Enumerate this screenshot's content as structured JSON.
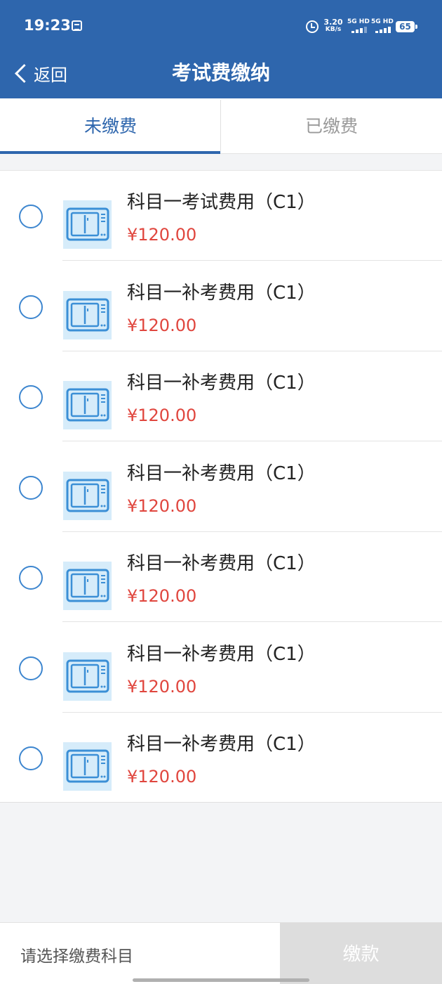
{
  "status_bar": {
    "time": "19:23",
    "net_speed_value": "3.20",
    "net_speed_unit": "KB/s",
    "signal1_label": "5G HD",
    "signal2_label": "5G HD",
    "battery": "65"
  },
  "header": {
    "back_label": "返回",
    "title": "考试费缴纳",
    "color": "#2e66ad"
  },
  "tabs": [
    {
      "label": "未缴费",
      "active": true
    },
    {
      "label": "已缴费",
      "active": false
    }
  ],
  "items": [
    {
      "name": "科目一考试费用（C1）",
      "price": "¥120.00",
      "selected": false,
      "icon": "exam-fee-icon"
    },
    {
      "name": "科目一补考费用（C1）",
      "price": "¥120.00",
      "selected": false,
      "icon": "exam-fee-icon"
    },
    {
      "name": "科目一补考费用（C1）",
      "price": "¥120.00",
      "selected": false,
      "icon": "exam-fee-icon"
    },
    {
      "name": "科目一补考费用（C1）",
      "price": "¥120.00",
      "selected": false,
      "icon": "exam-fee-icon"
    },
    {
      "name": "科目一补考费用（C1）",
      "price": "¥120.00",
      "selected": false,
      "icon": "exam-fee-icon"
    },
    {
      "name": "科目一补考费用（C1）",
      "price": "¥120.00",
      "selected": false,
      "icon": "exam-fee-icon"
    },
    {
      "name": "科目一补考费用（C1）",
      "price": "¥120.00",
      "selected": false,
      "icon": "exam-fee-icon"
    }
  ],
  "footer": {
    "hint": "请选择缴费科目",
    "pay_label": "缴款"
  },
  "colors": {
    "accent": "#2e66ad",
    "price": "#e0463e",
    "disabled_button": "#dddddd"
  }
}
